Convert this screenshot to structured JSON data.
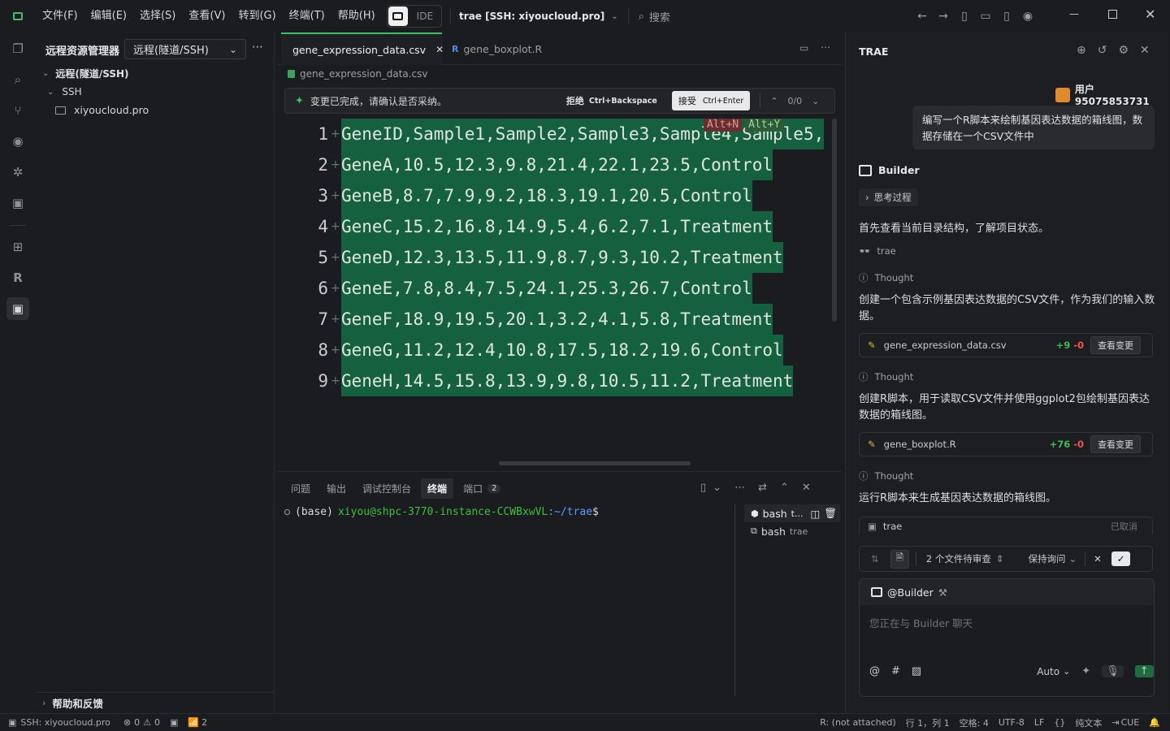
{
  "menu": {
    "file": "文件(F)",
    "edit": "编辑(E)",
    "select": "选择(S)",
    "view": "查看(V)",
    "goto": "转到(G)",
    "terminal": "终端(T)",
    "help": "帮助(H)",
    "ide_label": "IDE",
    "workspace": "trae [SSH: xiyoucloud.pro]",
    "search_placeholder": "搜索"
  },
  "sidebar": {
    "title": "远程资源管理器",
    "dropdown": "远程(隧道/SSH)",
    "section": "远程(隧道/SSH)",
    "group": "SSH",
    "host": "xiyoucloud.pro",
    "footer": "帮助和反馈"
  },
  "editor": {
    "tabs": [
      {
        "label": "gene_expression_data.csv"
      },
      {
        "label": "gene_boxplot.R"
      }
    ],
    "breadcrumb": "gene_expression_data.csv",
    "review_msg": "变更已完成，请确认是否采纳。",
    "reject": "拒绝",
    "reject_key": "Ctrl+Backspace",
    "accept": "接受",
    "accept_key": "Ctrl+Enter",
    "counter": "0/0",
    "hint_n": "Alt+N",
    "hint_y": "Alt+Y",
    "lines": [
      {
        "n": "1",
        "text": "GeneID,Sample1,Sample2,Sample3,Sample4,Sample5,"
      },
      {
        "n": "2",
        "text": "GeneA,10.5,12.3,9.8,21.4,22.1,23.5,Control"
      },
      {
        "n": "3",
        "text": "GeneB,8.7,7.9,9.2,18.3,19.1,20.5,Control"
      },
      {
        "n": "4",
        "text": "GeneC,15.2,16.8,14.9,5.4,6.2,7.1,Treatment"
      },
      {
        "n": "5",
        "text": "GeneD,12.3,13.5,11.9,8.7,9.3,10.2,Treatment"
      },
      {
        "n": "6",
        "text": "GeneE,7.8,8.4,7.5,24.1,25.3,26.7,Control"
      },
      {
        "n": "7",
        "text": "GeneF,18.9,19.5,20.1,3.2,4.1,5.8,Treatment"
      },
      {
        "n": "8",
        "text": "GeneG,11.2,12.4,10.8,17.5,18.2,19.6,Control"
      },
      {
        "n": "9",
        "text": "GeneH,14.5,15.8,13.9,9.8,10.5,11.2,Treatment"
      }
    ]
  },
  "panel": {
    "tabs": [
      "问题",
      "输出",
      "调试控制台",
      "终端",
      "端口"
    ],
    "ports_count": "2",
    "prompt_base": "(base)",
    "prompt_user": "xiyou@shpc-3770-instance-CCWBxwVL",
    "prompt_path": ":~/trae",
    "prompt_end": "$",
    "terminals": [
      {
        "name": "bash",
        "detail": "t..."
      },
      {
        "name": "bash",
        "detail": "trae"
      }
    ]
  },
  "trae": {
    "title": "TRAE",
    "user": "用户95075853731",
    "user_msg": "编写一个R脚本来绘制基因表达数据的箱线图，数据存储在一个CSV文件中",
    "agent": "Builder",
    "thinking": "思考过程",
    "step1": "首先查看当前目录结构，了解项目状态。",
    "tool1": "trae",
    "thought_label": "Thought",
    "thought1": "创建一个包含示例基因表达数据的CSV文件，作为我们的输入数据。",
    "file1": "gene_expression_data.csv",
    "file1_add": "+9",
    "file1_del": "-0",
    "view_changes": "查看变更",
    "thought2": "创建R脚本，用于读取CSV文件并使用ggplot2包绘制基因表达数据的箱线图。",
    "file2": "gene_boxplot.R",
    "file2_add": "+76",
    "file2_del": "-0",
    "thought3": "运行R脚本来生成基因表达数据的箱线图。",
    "cmd": "trae",
    "cmd_status": "已取消",
    "pending": "2 个文件待审查",
    "keep_ask": "保持询问",
    "mention": "@Builder",
    "input_placeholder": "您正在与 Builder 聊天",
    "model": "Auto"
  },
  "status": {
    "remote": "SSH: xiyoucloud.pro",
    "errors": "0",
    "warnings": "0",
    "ports": "2",
    "r_status": "R: (not attached)",
    "position": "行 1，列 1",
    "spaces": "空格: 4",
    "encoding": "UTF-8",
    "eol": "LF",
    "braces": "{}",
    "lang": "纯文本",
    "cue": "CUE"
  },
  "colors": {
    "accent_green": "#15613f",
    "add_green": "#3fb950",
    "del_red": "#f85149",
    "prompt_green": "#3fbf3f",
    "prompt_blue": "#5c9cff"
  }
}
